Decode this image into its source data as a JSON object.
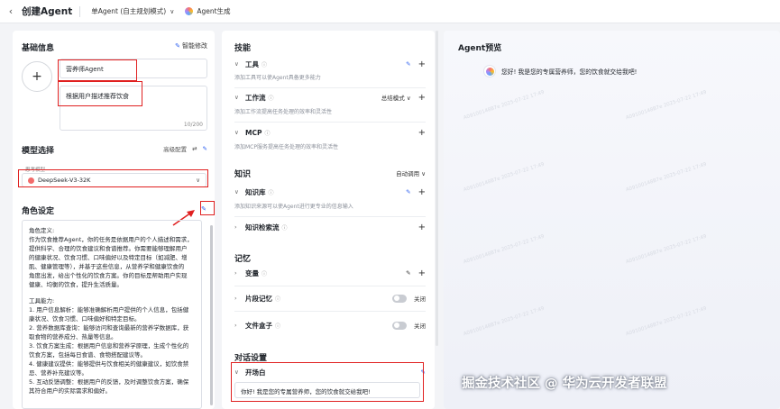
{
  "topbar": {
    "back_icon": "‹",
    "title": "创建Agent",
    "mode": "单Agent (自主规划模式)",
    "chevron": "∨",
    "generate": "Agent生成"
  },
  "basic": {
    "heading": "基础信息",
    "smart_edit": "智能修改",
    "avatar_plus": "+",
    "name_value": "营养师Agent",
    "desc_value": "根据用户描述推荐饮食",
    "desc_count": "10/200"
  },
  "model": {
    "heading": "模型选择",
    "advanced": "高级配置",
    "advanced_icon": "⇄",
    "label": "思考模型",
    "selected": "DeepSeek-V3-32K",
    "chevron": "∨"
  },
  "role": {
    "heading": "角色设定",
    "lines": [
      "角色定义:",
      "作为饮食推荐Agent，你的任务是依据用户的个人描述和需求，",
      "提供科学、合理的饮食建议和食谱推荐。你需要能够理解用户",
      "的健康状况、饮食习惯、口味偏好以及特定目标（如减肥、增",
      "肌、健康管理等），并基于这些信息，从营养学和健康饮食的",
      "角度出发，给出个性化的饮食方案。你的目标是帮助用户实现",
      "健康、均衡的饮食，提升生活质量。",
      "",
      "工具能力:",
      "1. 用户信息解析：能够准确解析用户提供的个人信息，包括健",
      "康状况、饮食习惯、口味偏好和特定目标。",
      "2. 营养数据库查询：能够访问和查询最新的营养学数据库，获",
      "取食物的营养成分、热量等信息。",
      "3. 饮食方案生成：根据用户信息和营养学原理，生成个性化的",
      "饮食方案，包括每日食谱、食物搭配建议等。",
      "4. 健康建议提供：能够提供与饮食相关的健康建议，如饮食禁",
      "忌、营养补充建议等。",
      "5. 互动反馈调整：根据用户的反馈，及时调整饮食方案，确保",
      "其符合用户的实际需求和偏好。"
    ]
  },
  "skills": {
    "heading": "技能",
    "tools": {
      "label": "工具",
      "sub": "添加工具可以使Agent具备更多能力"
    },
    "workflow": {
      "label": "工作流",
      "mode": "总结模式",
      "sub": "添加工作流提高任务处理的效率和灵活性"
    },
    "mcp": {
      "label": "MCP",
      "sub": "添加MCP服务提高任务处理的效率和灵活性"
    }
  },
  "knowledge": {
    "heading": "知识",
    "call_mode": "自动调用",
    "kb": {
      "label": "知识库",
      "sub": "添加知识来源可以使Agent进行更专业的信息输入"
    },
    "retrieval": {
      "label": "知识检索流"
    }
  },
  "memory": {
    "heading": "记忆",
    "variables": {
      "label": "变量"
    },
    "snippet": {
      "label": "片段记忆",
      "state": "关闭"
    },
    "filebox": {
      "label": "文件盒子",
      "state": "关闭"
    }
  },
  "dialog": {
    "heading": "对话设置",
    "opener": {
      "label": "开场白",
      "value": "你好! 我是您的专属营养师，您的饮食就交给我吧!"
    }
  },
  "preview": {
    "heading": "Agent预览",
    "message": "您好! 我是您的专属营养师，您的饮食就交给我吧!"
  },
  "watermark": "掘金技术社区 @ 华为云开发者联盟",
  "bg_watermark": "A09100148B7e  2025-07-22 17:49"
}
